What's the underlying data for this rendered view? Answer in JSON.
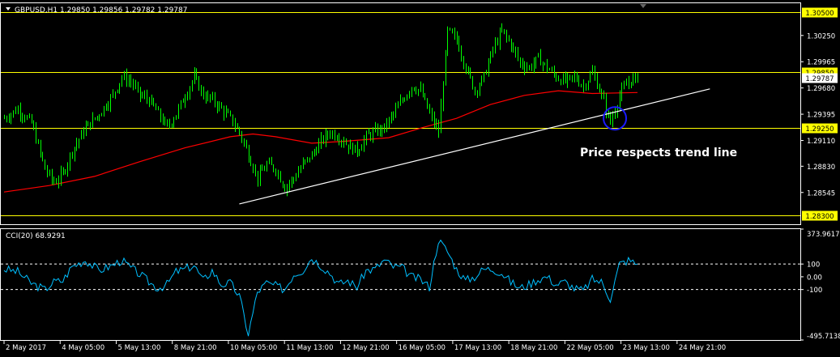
{
  "header": {
    "symbol_line": "GBPUSD,H1  1.29850 1.29856 1.29782 1.29787"
  },
  "colors": {
    "background": "#000000",
    "frame": "#ffffff",
    "candles": "#00ff00",
    "moving_average": "#ff0000",
    "trend_line": "#ffffff",
    "level_lines": "#ffff00",
    "level_label_bg": "#ffff00",
    "cci_line": "#00bfff",
    "annotation_circle": "#1a1aff",
    "axis_text": "#ffffff"
  },
  "annotation": {
    "text": "Price respects trend line"
  },
  "chart_data": [
    {
      "type": "line",
      "title": "",
      "series_kind": "candlestick",
      "ylim": [
        1.282,
        1.306
      ],
      "y_ticks": [
        1.3025,
        1.29965,
        1.2968,
        1.29395,
        1.2911,
        1.2883,
        1.28545
      ],
      "y_tick_labels": [
        "1.30250",
        "1.29965",
        "1.29680",
        "1.29395",
        "1.29110",
        "1.28830",
        "1.28545"
      ],
      "horizontal_levels": [
        {
          "value": 1.305,
          "label": "1.30500"
        },
        {
          "value": 1.2985,
          "label": "1.29850"
        },
        {
          "value": 1.2925,
          "label": "1.29250"
        },
        {
          "value": 1.283,
          "label": "1.28300"
        }
      ],
      "current_price": {
        "value": 1.29787,
        "label": "1.29787"
      },
      "x_labels": [
        "2 May 2017",
        "4 May 05:00",
        "5 May 13:00",
        "8 May 21:00",
        "10 May 05:00",
        "11 May 13:00",
        "12 May 21:00",
        "16 May 05:00",
        "17 May 13:00",
        "18 May 21:00",
        "22 May 05:00",
        "23 May 13:00",
        "24 May 21:00"
      ],
      "price_path": [
        [
          0,
          1.2935
        ],
        [
          6,
          1.2945
        ],
        [
          12,
          1.293
        ],
        [
          18,
          1.288
        ],
        [
          22,
          1.2865
        ],
        [
          26,
          1.2875
        ],
        [
          30,
          1.29
        ],
        [
          36,
          1.2925
        ],
        [
          42,
          1.294
        ],
        [
          48,
          1.296
        ],
        [
          52,
          1.298
        ],
        [
          56,
          1.2975
        ],
        [
          60,
          1.296
        ],
        [
          64,
          1.2955
        ],
        [
          68,
          1.294
        ],
        [
          72,
          1.2925
        ],
        [
          76,
          1.294
        ],
        [
          80,
          1.296
        ],
        [
          84,
          1.298
        ],
        [
          88,
          1.296
        ],
        [
          92,
          1.2955
        ],
        [
          96,
          1.2945
        ],
        [
          100,
          1.2935
        ],
        [
          104,
          1.292
        ],
        [
          108,
          1.2895
        ],
        [
          112,
          1.287
        ],
        [
          116,
          1.2885
        ],
        [
          120,
          1.288
        ],
        [
          124,
          1.286
        ],
        [
          128,
          1.287
        ],
        [
          132,
          1.2885
        ],
        [
          136,
          1.2895
        ],
        [
          140,
          1.291
        ],
        [
          144,
          1.292
        ],
        [
          148,
          1.2915
        ],
        [
          152,
          1.2905
        ],
        [
          156,
          1.29
        ],
        [
          160,
          1.2915
        ],
        [
          164,
          1.292
        ],
        [
          168,
          1.2925
        ],
        [
          172,
          1.294
        ],
        [
          176,
          1.2955
        ],
        [
          180,
          1.297
        ],
        [
          184,
          1.2965
        ],
        [
          188,
          1.294
        ],
        [
          192,
          1.292
        ],
        [
          196,
          1.303
        ],
        [
          200,
          1.302
        ],
        [
          204,
          1.299
        ],
        [
          208,
          1.2965
        ],
        [
          212,
          1.298
        ],
        [
          216,
          1.301
        ],
        [
          220,
          1.303
        ],
        [
          224,
          1.3015
        ],
        [
          228,
          1.2995
        ],
        [
          232,
          1.299
        ],
        [
          236,
          1.3
        ],
        [
          240,
          1.299
        ],
        [
          244,
          1.298
        ],
        [
          248,
          1.2975
        ],
        [
          252,
          1.298
        ],
        [
          256,
          1.297
        ],
        [
          260,
          1.2985
        ],
        [
          264,
          1.296
        ],
        [
          268,
          1.293
        ],
        [
          272,
          1.296
        ],
        [
          276,
          1.2975
        ],
        [
          280,
          1.2979
        ]
      ],
      "moving_average_path": [
        [
          0,
          1.2855
        ],
        [
          20,
          1.2862
        ],
        [
          40,
          1.2872
        ],
        [
          60,
          1.2888
        ],
        [
          80,
          1.2903
        ],
        [
          100,
          1.2915
        ],
        [
          110,
          1.2918
        ],
        [
          120,
          1.2915
        ],
        [
          136,
          1.2908
        ],
        [
          150,
          1.291
        ],
        [
          170,
          1.2914
        ],
        [
          185,
          1.2925
        ],
        [
          200,
          1.2935
        ],
        [
          215,
          1.295
        ],
        [
          230,
          1.296
        ],
        [
          245,
          1.2965
        ],
        [
          260,
          1.2962
        ],
        [
          280,
          1.2963
        ]
      ],
      "trend_line": {
        "start": [
          104,
          1.2842
        ],
        "end": [
          312,
          1.2967
        ]
      },
      "annotation_circle_at": [
        270,
        1.2935
      ]
    },
    {
      "type": "line",
      "title": "CCI(20) 68.9291",
      "ylim": [
        -495.7138,
        373.9617
      ],
      "y_ticks": [
        373.9617,
        100,
        0.0,
        -100,
        -495.7138
      ],
      "y_tick_labels": [
        "373.9617",
        "100",
        "0.00",
        "-100",
        "-495.7138"
      ],
      "dashed_levels": [
        100,
        -100
      ],
      "series": [
        {
          "values": [
            [
              0,
              60
            ],
            [
              6,
              40
            ],
            [
              12,
              -50
            ],
            [
              18,
              -100
            ],
            [
              22,
              -40
            ],
            [
              26,
              -30
            ],
            [
              30,
              80
            ],
            [
              36,
              130
            ],
            [
              42,
              50
            ],
            [
              48,
              90
            ],
            [
              52,
              130
            ],
            [
              56,
              70
            ],
            [
              60,
              20
            ],
            [
              64,
              -40
            ],
            [
              68,
              -90
            ],
            [
              72,
              -60
            ],
            [
              76,
              40
            ],
            [
              80,
              60
            ],
            [
              84,
              90
            ],
            [
              88,
              -30
            ],
            [
              92,
              50
            ],
            [
              96,
              -60
            ],
            [
              100,
              -50
            ],
            [
              104,
              -150
            ],
            [
              108,
              -450
            ],
            [
              112,
              -120
            ],
            [
              116,
              -50
            ],
            [
              120,
              -70
            ],
            [
              124,
              -100
            ],
            [
              128,
              20
            ],
            [
              132,
              50
            ],
            [
              136,
              150
            ],
            [
              140,
              90
            ],
            [
              144,
              30
            ],
            [
              148,
              -60
            ],
            [
              152,
              -30
            ],
            [
              156,
              -80
            ],
            [
              160,
              50
            ],
            [
              164,
              60
            ],
            [
              168,
              130
            ],
            [
              172,
              80
            ],
            [
              176,
              70
            ],
            [
              180,
              0
            ],
            [
              184,
              -20
            ],
            [
              188,
              -80
            ],
            [
              192,
              290
            ],
            [
              196,
              200
            ],
            [
              200,
              60
            ],
            [
              204,
              -30
            ],
            [
              208,
              0
            ],
            [
              212,
              60
            ],
            [
              216,
              60
            ],
            [
              220,
              30
            ],
            [
              224,
              -40
            ],
            [
              228,
              -90
            ],
            [
              232,
              -60
            ],
            [
              236,
              -20
            ],
            [
              240,
              0
            ],
            [
              244,
              -60
            ],
            [
              248,
              -40
            ],
            [
              252,
              -90
            ],
            [
              256,
              -110
            ],
            [
              260,
              -20
            ],
            [
              264,
              -40
            ],
            [
              268,
              -170
            ],
            [
              272,
              100
            ],
            [
              276,
              130
            ],
            [
              280,
              100
            ]
          ]
        }
      ]
    }
  ]
}
